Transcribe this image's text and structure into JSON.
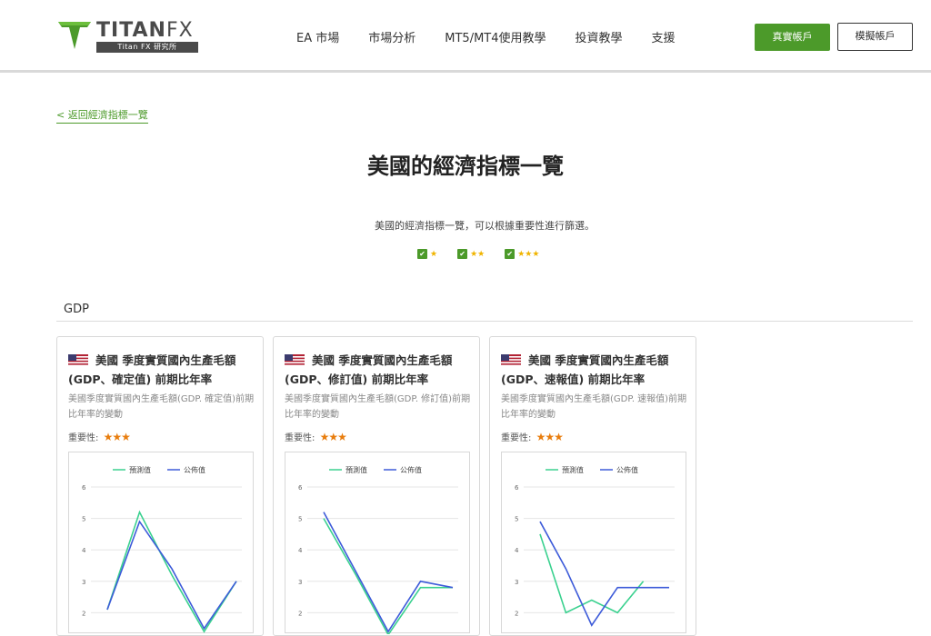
{
  "brand": {
    "name_main": "TITAN",
    "name_fx": "FX",
    "tagline": "Titan FX 研究所"
  },
  "nav": {
    "items": [
      "EA 市場",
      "市場分析",
      "MT5/MT4使用教學",
      "投資教學",
      "支援"
    ]
  },
  "header_buttons": {
    "real": "真實帳戶",
    "demo": "模擬帳戶"
  },
  "back_link": "< 返回經濟指標一覽",
  "page_title": "美國的經濟指標一覽",
  "subtitle": "美國的經濟指標一覽，可以根據重要性進行篩選。",
  "filters": [
    {
      "checked": true,
      "stars": "★"
    },
    {
      "checked": true,
      "stars": "★★"
    },
    {
      "checked": true,
      "stars": "★★★"
    }
  ],
  "section": {
    "title": "GDP"
  },
  "colors": {
    "accent": "#4c9a2a",
    "forecast": "#3ad18f",
    "actual": "#3d5bd9",
    "star": "#e87d0d"
  },
  "cards": [
    {
      "title": "美國 季度實質國內生產毛額(GDP、確定值) 前期比年率",
      "desc": "美國季度實質國內生產毛額(GDP. 確定值)前期比年率的變動",
      "importance_label": "重要性:",
      "importance_stars": "★★★",
      "chart_data": {
        "type": "line",
        "x": [
          1,
          2,
          3,
          4,
          5
        ],
        "series": [
          {
            "name": "預測值",
            "values": [
              2.1,
              5.2,
              3.2,
              1.4,
              3.0
            ]
          },
          {
            "name": "公佈值",
            "values": [
              2.1,
              4.9,
              3.4,
              1.5,
              3.0
            ]
          }
        ],
        "yticks": [
          2,
          3,
          4,
          5,
          6
        ],
        "ylim": [
          1.5,
          6
        ],
        "legend": "top"
      }
    },
    {
      "title": "美國 季度實質國內生產毛額(GDP、修訂值) 前期比年率",
      "desc": "美國季度實質國內生產毛額(GDP. 修訂值)前期比年率的變動",
      "importance_label": "重要性:",
      "importance_stars": "★★★",
      "chart_data": {
        "type": "line",
        "x": [
          1,
          2,
          3,
          4,
          5
        ],
        "series": [
          {
            "name": "預測值",
            "values": [
              5.0,
              3.2,
              1.3,
              2.8,
              2.8
            ]
          },
          {
            "name": "公佈值",
            "values": [
              5.2,
              3.3,
              1.4,
              3.0,
              2.8
            ]
          }
        ],
        "yticks": [
          2,
          3,
          4,
          5,
          6
        ],
        "ylim": [
          1.5,
          6
        ],
        "legend": "top"
      }
    },
    {
      "title": "美國 季度實質國內生產毛額(GDP、速報值) 前期比年率",
      "desc": "美國季度實質國內生產毛額(GDP. 速報值)前期比年率的變動",
      "importance_label": "重要性:",
      "importance_stars": "★★★",
      "chart_data": {
        "type": "line",
        "x": [
          1,
          2,
          3,
          4,
          5,
          6
        ],
        "series": [
          {
            "name": "預測值",
            "values": [
              4.5,
              2.0,
              2.4,
              2.0,
              3.0
            ]
          },
          {
            "name": "公佈值",
            "values": [
              4.9,
              3.4,
              1.6,
              2.8,
              2.8,
              2.8
            ]
          }
        ],
        "yticks": [
          2,
          3,
          4,
          5,
          6
        ],
        "ylim": [
          1.5,
          6
        ],
        "legend": "top"
      }
    }
  ]
}
